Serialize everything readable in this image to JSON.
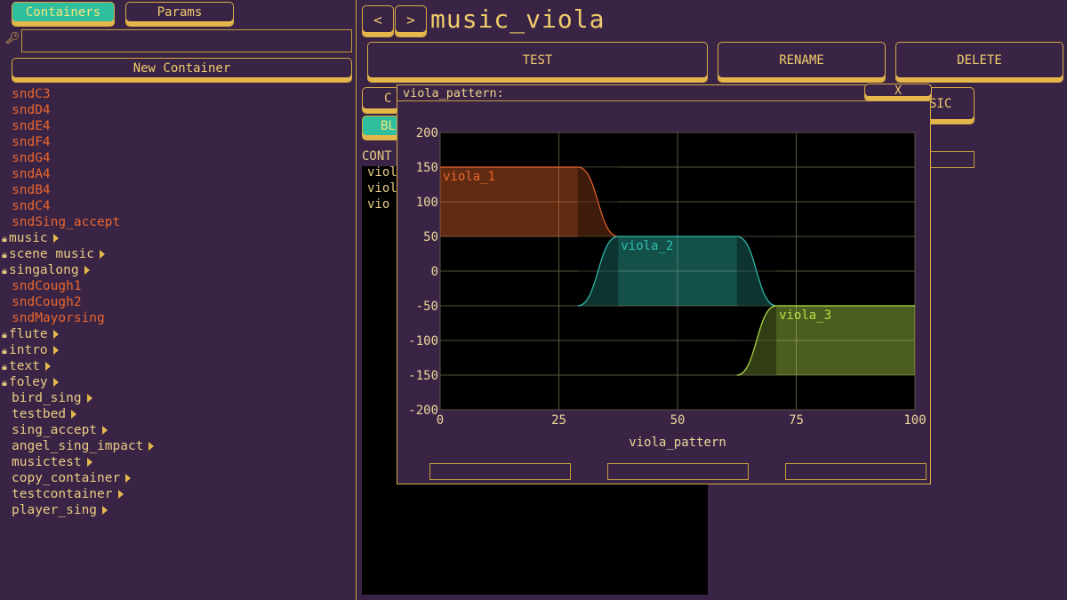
{
  "tabs": {
    "containers": "Containers",
    "params": "Params"
  },
  "search": {
    "icon": "key-icon",
    "value": ""
  },
  "new_container": "New Container",
  "list": [
    {
      "label": "sndC3",
      "kind": "snd"
    },
    {
      "label": "sndD4",
      "kind": "snd"
    },
    {
      "label": "sndE4",
      "kind": "snd"
    },
    {
      "label": "sndF4",
      "kind": "snd"
    },
    {
      "label": "sndG4",
      "kind": "snd"
    },
    {
      "label": "sndA4",
      "kind": "snd"
    },
    {
      "label": "sndB4",
      "kind": "snd"
    },
    {
      "label": "sndC4",
      "kind": "snd"
    },
    {
      "label": "sndSing_accept",
      "kind": "snd"
    },
    {
      "label": "music",
      "kind": "container",
      "locked": true
    },
    {
      "label": "scene music",
      "kind": "container",
      "locked": true
    },
    {
      "label": "singalong",
      "kind": "container",
      "locked": true
    },
    {
      "label": "sndCough1",
      "kind": "snd"
    },
    {
      "label": "sndCough2",
      "kind": "snd"
    },
    {
      "label": "sndMayorsing",
      "kind": "snd"
    },
    {
      "label": "flute",
      "kind": "container",
      "locked": true
    },
    {
      "label": "intro",
      "kind": "container",
      "locked": true
    },
    {
      "label": "text",
      "kind": "container",
      "locked": true
    },
    {
      "label": "foley",
      "kind": "container",
      "locked": true
    },
    {
      "label": "bird_sing",
      "kind": "container",
      "locked": false
    },
    {
      "label": "testbed",
      "kind": "container",
      "locked": false
    },
    {
      "label": "sing_accept",
      "kind": "container",
      "locked": false
    },
    {
      "label": "angel_sing_impact",
      "kind": "container",
      "locked": false
    },
    {
      "label": "musictest",
      "kind": "container",
      "locked": false
    },
    {
      "label": "copy_container",
      "kind": "container",
      "locked": false
    },
    {
      "label": "testcontainer",
      "kind": "container",
      "locked": false
    },
    {
      "label": "player_sing",
      "kind": "container",
      "locked": false
    }
  ],
  "nav": {
    "back": "<",
    "forward": ">"
  },
  "title": "music_viola",
  "actions": {
    "test": "TEST",
    "rename": "RENAME",
    "delete": "DELETE"
  },
  "partial": {
    "left_btn": "C",
    "right_btn": "SIC",
    "bl_tab": "BL",
    "cont_label": "CONT",
    "items": [
      "viol",
      "viol",
      "vio"
    ]
  },
  "popup": {
    "title": "viola_pattern:",
    "close": "X",
    "fields": [
      "",
      "",
      ""
    ]
  },
  "chart_data": {
    "type": "area",
    "title": "",
    "xlabel": "viola_pattern",
    "ylabel": "",
    "xlim": [
      0,
      100
    ],
    "ylim": [
      -200,
      200
    ],
    "xticks": [
      0,
      25,
      50,
      75,
      100
    ],
    "yticks": [
      200,
      150,
      100,
      50,
      0,
      -50,
      -100,
      -150,
      -200
    ],
    "grid": true,
    "series": [
      {
        "name": "viola_1",
        "color": "#e8652c",
        "low": 50,
        "high": 150,
        "fade_in": [
          0,
          0
        ],
        "sustain": [
          0,
          29
        ],
        "fade_out": [
          29,
          37.5
        ]
      },
      {
        "name": "viola_2",
        "color": "#2fbfb0",
        "low": -50,
        "high": 50,
        "fade_in": [
          29,
          37.5
        ],
        "sustain": [
          37.5,
          62.5
        ],
        "fade_out": [
          62.5,
          70.8
        ]
      },
      {
        "name": "viola_3",
        "color": "#b4e04a",
        "low": -150,
        "high": -50,
        "fade_in": [
          62.5,
          70.8
        ],
        "sustain": [
          70.8,
          100
        ],
        "fade_out": [
          100,
          100
        ]
      }
    ]
  }
}
